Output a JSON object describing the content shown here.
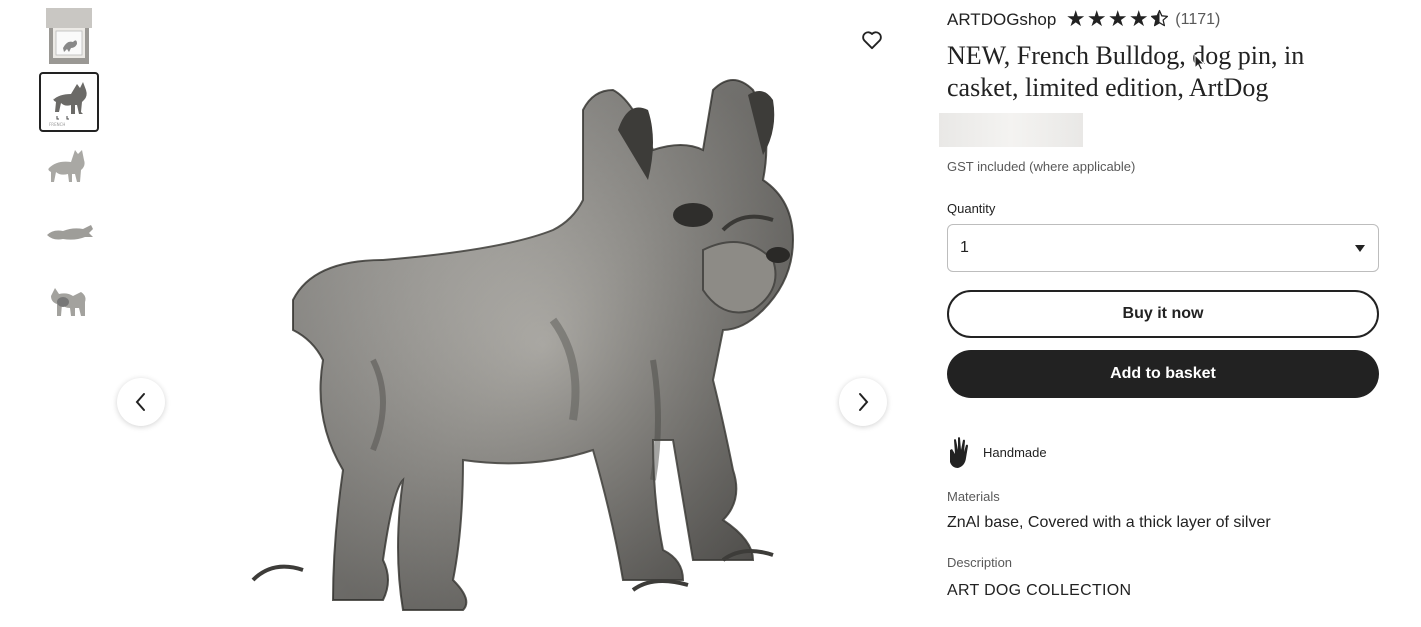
{
  "gallery": {
    "thumbnails": [
      {
        "name": "thumb-casket",
        "selected": false
      },
      {
        "name": "thumb-front",
        "selected": true
      },
      {
        "name": "thumb-side",
        "selected": false
      },
      {
        "name": "thumb-top",
        "selected": false
      },
      {
        "name": "thumb-back",
        "selected": false
      }
    ],
    "favorite_icon": "heart-outline-icon",
    "prev_icon": "chevron-left-icon",
    "next_icon": "chevron-right-icon"
  },
  "listing": {
    "shop_name": "ARTDOGshop",
    "rating": 4.5,
    "review_count": "(1171)",
    "title": "NEW, French Bulldog, dog pin, in casket, limited edition, ArtDog",
    "gst_note": "GST included (where applicable)",
    "quantity_label": "Quantity",
    "quantity_value": "1",
    "buy_now_label": "Buy it now",
    "add_to_basket_label": "Add to basket",
    "handmade_label": "Handmade",
    "materials_label": "Materials",
    "materials_value": "ZnAl base, Covered with a thick layer of silver",
    "description_label": "Description",
    "description_value": "ART DOG COLLECTION"
  },
  "colors": {
    "primary_button_bg": "#222222",
    "secondary_button_border": "#222222",
    "muted_text": "#595959"
  }
}
